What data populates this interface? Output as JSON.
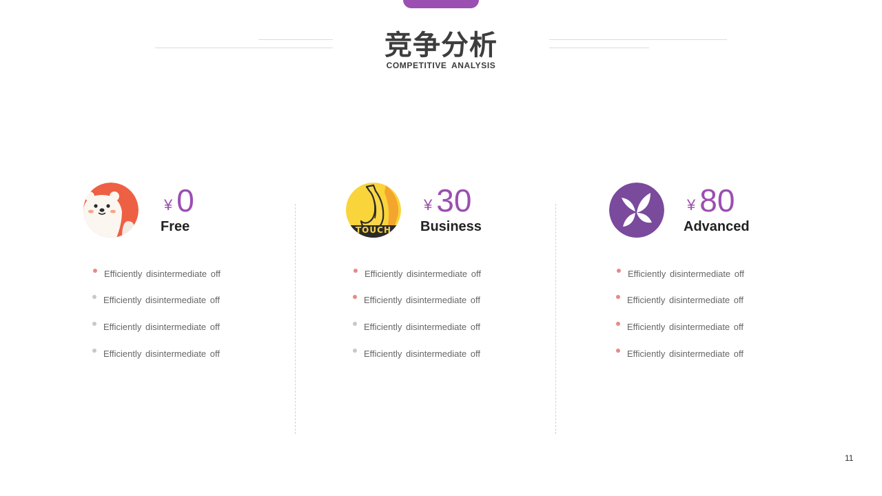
{
  "header": {
    "title": "竞争分析",
    "subtitle": "COMPETITIVE ANALYSIS"
  },
  "plans": [
    {
      "currency": "¥",
      "price": "0",
      "name": "Free",
      "icon": "bear-icon",
      "features": [
        "Efficiently disintermediate off",
        "Efficiently disintermediate off",
        "Efficiently disintermediate off",
        "Efficiently disintermediate off"
      ]
    },
    {
      "currency": "¥",
      "price": "30",
      "name": "Business",
      "icon": "banana-icon",
      "icon_text": "TOUCH",
      "features": [
        "Efficiently disintermediate off",
        "Efficiently disintermediate off",
        "Efficiently disintermediate off",
        "Efficiently disintermediate off"
      ]
    },
    {
      "currency": "¥",
      "price": "80",
      "name": "Advanced",
      "icon": "butterfly-leaf-icon",
      "features": [
        "Efficiently disintermediate off",
        "Efficiently disintermediate off",
        "Efficiently disintermediate off",
        "Efficiently disintermediate off"
      ]
    }
  ],
  "colors": {
    "accent": "#9b4fb0",
    "bullet_pink": "#e88a86",
    "bullet_gray": "#c8c8c8",
    "bear_bg": "#ee6043",
    "banana_bg": "#f9d43a",
    "leaf_bg": "#7a4a9c"
  },
  "page_number": "11"
}
